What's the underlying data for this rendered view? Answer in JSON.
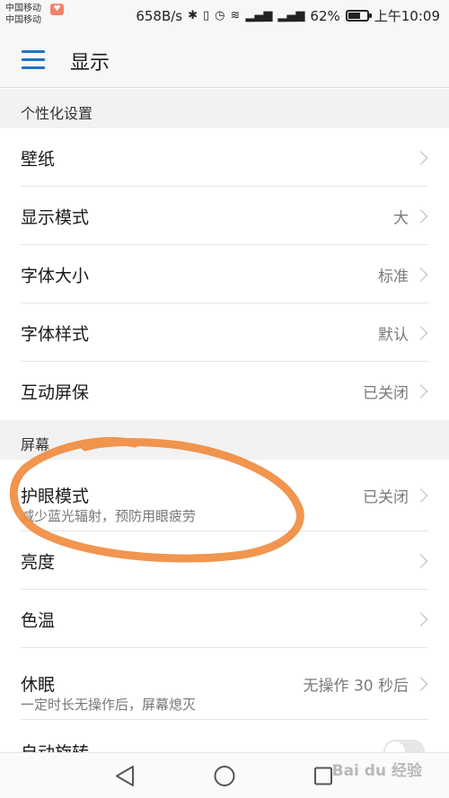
{
  "status_bar": {
    "carrier_1": "中国移动",
    "carrier_2": "中国移动",
    "network_speed": "658B/s",
    "battery": "62%",
    "battery_level": 0.62,
    "time": "上午10:09",
    "icons": [
      "bluetooth-icon",
      "vibrate-icon",
      "alarm-icon",
      "wifi-icon",
      "4g-signal-icon",
      "2g-signal-icon",
      "battery-icon"
    ]
  },
  "app_bar": {
    "title": "显示",
    "menu_icon": "menu-icon",
    "accent_color": "#1e73c9"
  },
  "sections": [
    {
      "header": "个性化设置",
      "items": [
        {
          "label": "壁纸",
          "value": ""
        },
        {
          "label": "显示模式",
          "value": "大"
        },
        {
          "label": "字体大小",
          "value": "标准"
        },
        {
          "label": "字体样式",
          "value": "默认"
        },
        {
          "label": "互动屏保",
          "value": "已关闭"
        }
      ]
    },
    {
      "header": "屏幕",
      "items": [
        {
          "label": "护眼模式",
          "sublabel": "减少蓝光辐射，预防用眼疲劳",
          "value": "已关闭"
        },
        {
          "label": "亮度",
          "value": ""
        },
        {
          "label": "色温",
          "value": ""
        },
        {
          "label": "休眠",
          "sublabel": "一定时长无操作后，屏幕熄灭",
          "value": "无操作 30 秒后"
        },
        {
          "label": "自动旋转",
          "value": ""
        }
      ]
    }
  ],
  "nav_bar": {
    "icons": [
      "back-triangle-icon",
      "home-circle-icon",
      "recent-square-icon"
    ]
  },
  "annotation_color": "#f08a3c",
  "watermark": "Bai du 经验"
}
